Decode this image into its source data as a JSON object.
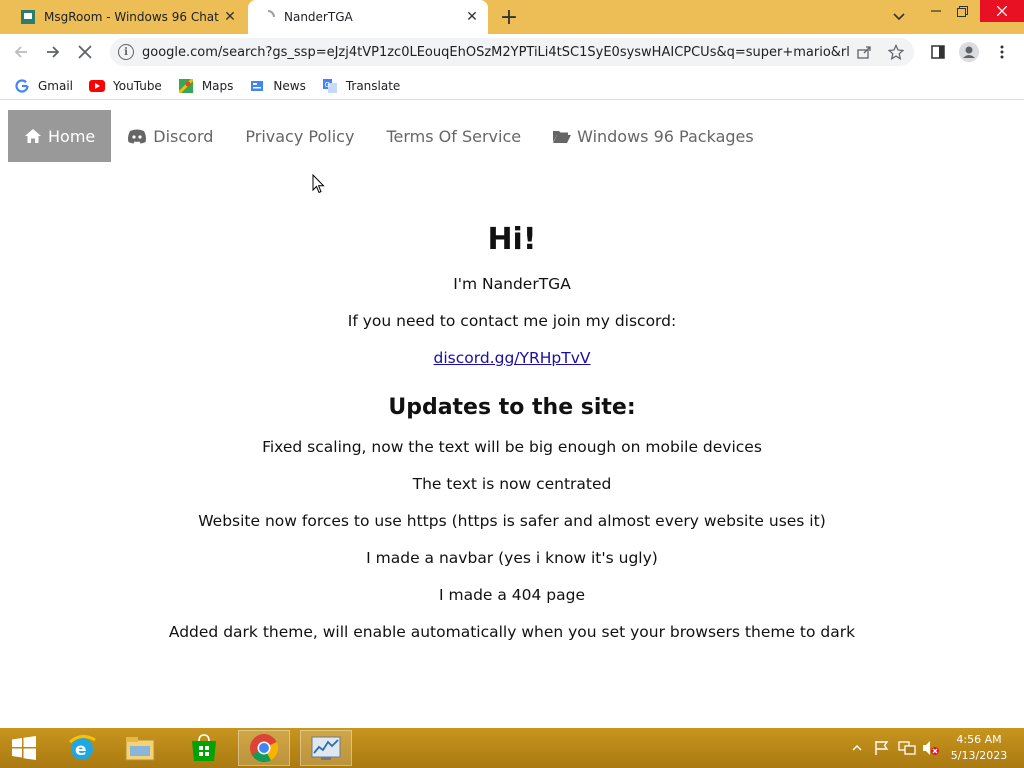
{
  "browser": {
    "tabs": [
      {
        "title": "MsgRoom - Windows 96 Chat",
        "active": false
      },
      {
        "title": "NanderTGA",
        "active": true
      }
    ],
    "url": "google.com/search?gs_ssp=eJzj4tVP1zc0LEouqEhOSzM2YPTiLi4tSC1SyE0syswHAICPCUs&q=super+mario&rlz=..."
  },
  "bookmarks": [
    {
      "label": "Gmail",
      "icon": "google-icon"
    },
    {
      "label": "YouTube",
      "icon": "youtube-icon"
    },
    {
      "label": "Maps",
      "icon": "maps-icon"
    },
    {
      "label": "News",
      "icon": "news-icon"
    },
    {
      "label": "Translate",
      "icon": "translate-icon"
    }
  ],
  "navbar": {
    "home": "Home",
    "discord": "Discord",
    "privacy": "Privacy Policy",
    "tos": "Terms Of Service",
    "packages": "Windows 96 Packages"
  },
  "content": {
    "heading": "Hi!",
    "intro": "I'm NanderTGA",
    "contact": "If you need to contact me join my discord:",
    "discord_link": "discord.gg/YRHpTvV",
    "updates_heading": "Updates to the site:",
    "updates": [
      "Fixed scaling, now the text will be big enough on mobile devices",
      "The text is now centrated",
      "Website now forces to use https (https is safer and almost every website uses it)",
      "I made a navbar (yes i know it's ugly)",
      "I made a 404 page",
      "Added dark theme, will enable automatically when you set your browsers theme to dark"
    ]
  },
  "taskbar": {
    "time": "4:56 AM",
    "date": "5/13/2023"
  },
  "colors": {
    "tabstrip": "#ecbe55",
    "nav_active": "#999999",
    "link": "#1a0dab",
    "taskbar": "#b8860b"
  }
}
